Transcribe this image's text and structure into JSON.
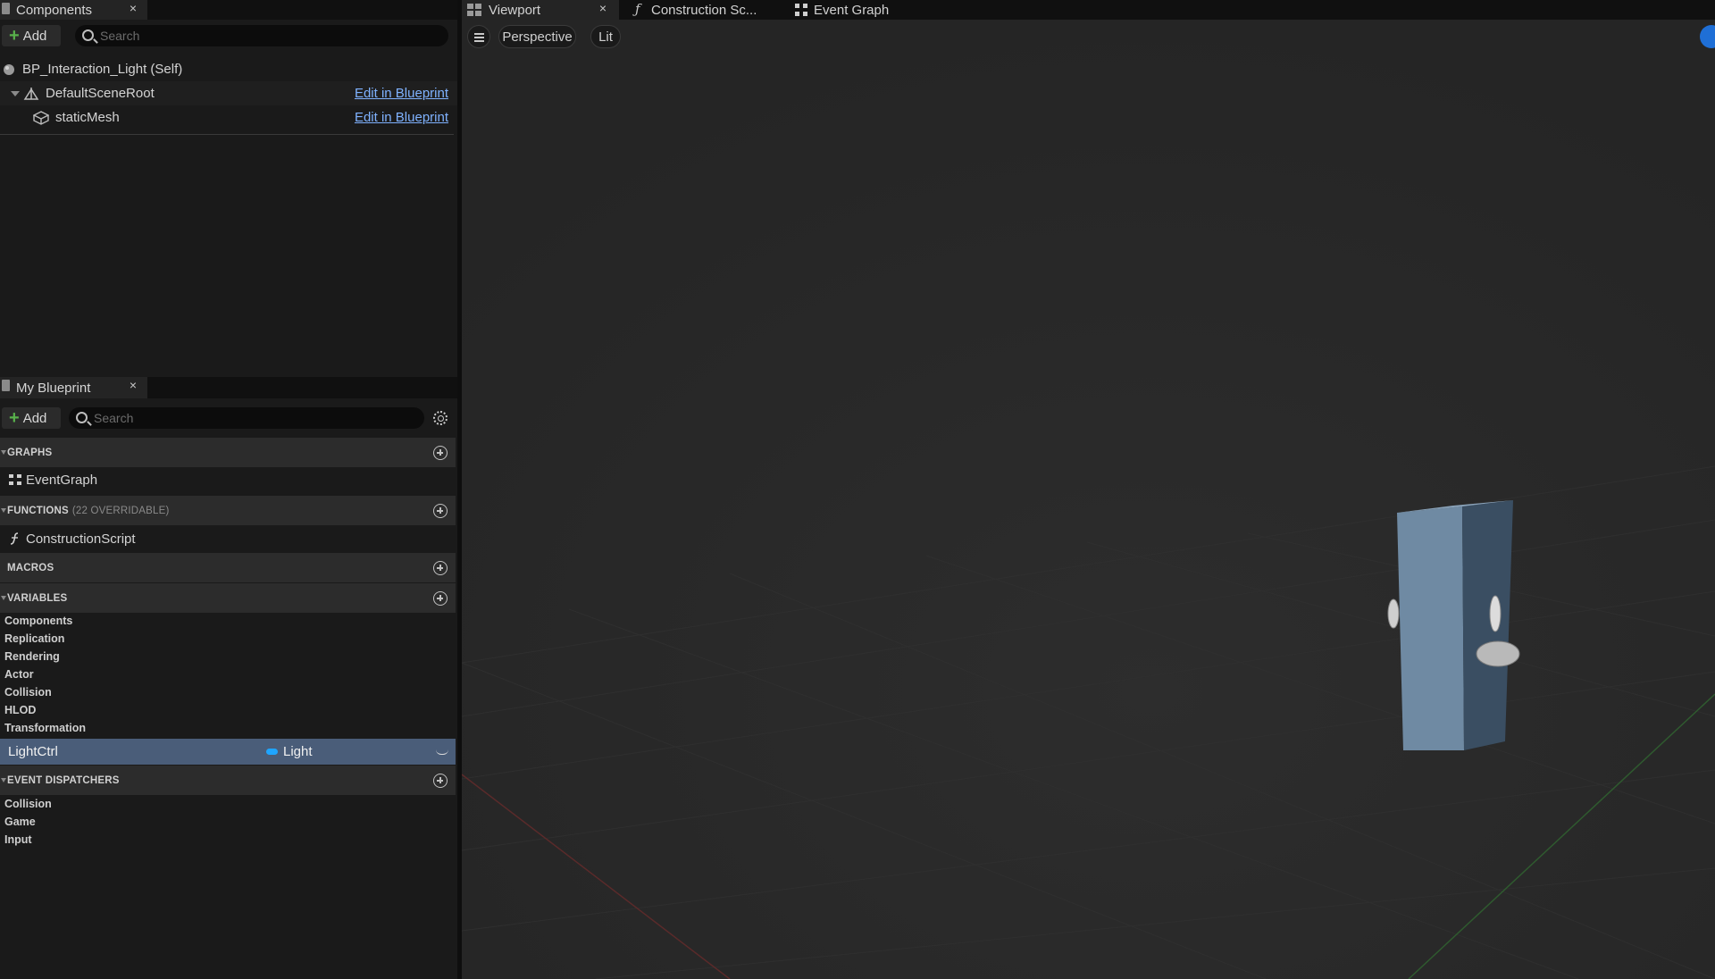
{
  "components": {
    "tab_label": "Components",
    "close": "×",
    "add_label": "Add",
    "search_placeholder": "Search",
    "self_label": "BP_Interaction_Light (Self)",
    "items": [
      {
        "label": "DefaultSceneRoot",
        "link": "Edit in Blueprint"
      },
      {
        "label": "staticMesh",
        "link": "Edit in Blueprint"
      }
    ]
  },
  "my_blueprint": {
    "tab_label": "My Blueprint",
    "close": "×",
    "add_label": "Add",
    "search_placeholder": "Search",
    "sections": {
      "graphs": {
        "title": "GRAPHS",
        "items": [
          "EventGraph"
        ]
      },
      "functions": {
        "title": "FUNCTIONS",
        "subtitle": "(22 OVERRIDABLE)",
        "items": [
          "ConstructionScript"
        ]
      },
      "macros": {
        "title": "MACROS"
      },
      "variables": {
        "title": "VARIABLES",
        "categories": [
          "Components",
          "Replication",
          "Rendering",
          "Actor",
          "Collision",
          "HLOD",
          "Transformation"
        ],
        "selected": {
          "name": "LightCtrl",
          "type": "Light",
          "type_color": "#1fa5ff"
        }
      },
      "event_dispatchers": {
        "title": "EVENT DISPATCHERS",
        "categories": [
          "Collision",
          "Game",
          "Input"
        ]
      }
    }
  },
  "viewport": {
    "tabs": [
      {
        "label": "Viewport",
        "close": "×",
        "icon": "viewport-grid-icon"
      },
      {
        "label": "Construction Sc...",
        "icon": "function-icon"
      },
      {
        "label": "Event Graph",
        "icon": "graph-icon"
      }
    ],
    "mode_label": "Perspective",
    "lighting_label": "Lit"
  },
  "colors": {
    "accent_link": "#7fb2ff",
    "selected_row": "#4a5d79",
    "add_plus": "#58b14b"
  }
}
